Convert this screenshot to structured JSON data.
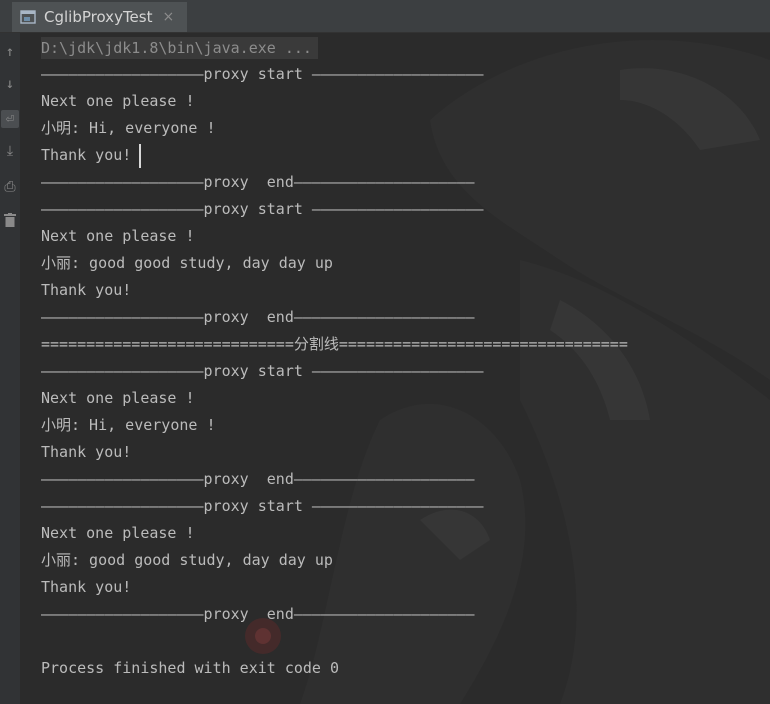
{
  "tab": {
    "title": "CglibProxyTest",
    "icon": "console-window-icon",
    "close": "×"
  },
  "toolbar": [
    {
      "icon": "up-arrow-icon",
      "glyph": "↑"
    },
    {
      "icon": "down-arrow-icon",
      "glyph": "↓"
    },
    {
      "icon": "soft-wrap-icon",
      "glyph": "⏎"
    },
    {
      "icon": "scroll-to-end-icon",
      "glyph": "⤓"
    },
    {
      "icon": "print-icon",
      "glyph": "⎙"
    },
    {
      "icon": "trash-icon",
      "glyph": "🗑"
    }
  ],
  "console": {
    "command": "D:\\jdk\\jdk1.8\\bin\\java.exe ...",
    "lines": [
      "——————————————————proxy start ———————————————————",
      "Next one please !",
      "小明: Hi, everyone !",
      "Thank you!",
      "——————————————————proxy  end————————————————————",
      "——————————————————proxy start ———————————————————",
      "Next one please !",
      "小丽: good good study, day day up",
      "Thank you!",
      "——————————————————proxy  end————————————————————",
      "============================分割线================================",
      "——————————————————proxy start ———————————————————",
      "Next one please !",
      "小明: Hi, everyone !",
      "Thank you!",
      "——————————————————proxy  end————————————————————",
      "——————————————————proxy start ———————————————————",
      "Next one please !",
      "小丽: good good study, day day up",
      "Thank you!",
      "——————————————————proxy  end————————————————————",
      "",
      "Process finished with exit code 0"
    ]
  },
  "colors": {
    "background": "#2b2b2b",
    "text": "#bbbbbb",
    "command": "#8c8c8c"
  }
}
